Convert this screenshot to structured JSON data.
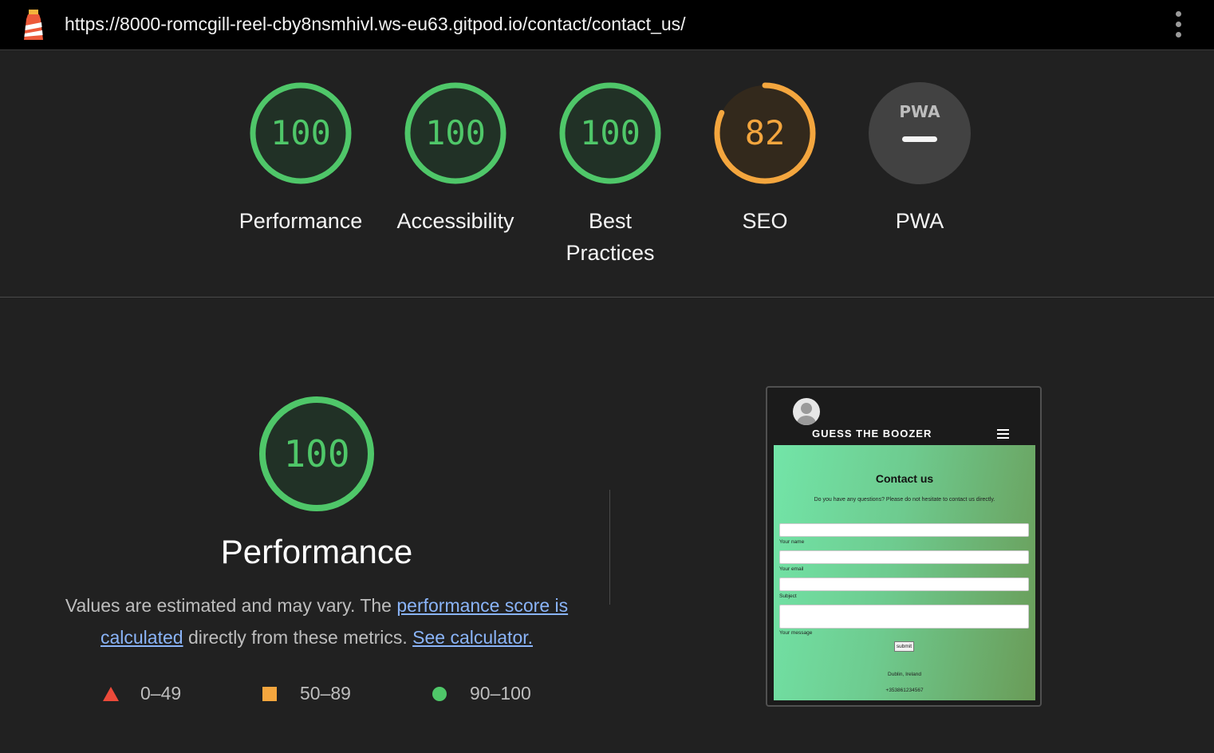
{
  "topbar": {
    "url": "https://8000-romcgill-reel-cby8nsmhivl.ws-eu63.gitpod.io/contact/contact_us/"
  },
  "colors": {
    "pass": "#4fc769",
    "average": "#f4a63e",
    "fail": "#ec4a3a",
    "link": "#8ab4f8"
  },
  "gauges": [
    {
      "label": "Performance",
      "score": "100",
      "value": 100,
      "status": "pass"
    },
    {
      "label": "Accessibility",
      "score": "100",
      "value": 100,
      "status": "pass"
    },
    {
      "label": "Best Practices",
      "score": "100",
      "value": 100,
      "status": "pass"
    },
    {
      "label": "SEO",
      "score": "82",
      "value": 82,
      "status": "average"
    },
    {
      "label": "PWA",
      "badge": "PWA",
      "status": "not-applicable"
    }
  ],
  "performance": {
    "score": "100",
    "title": "Performance",
    "desc_before": "Values are estimated and may vary. The ",
    "link_score": "performance score is calculated",
    "desc_middle": " directly from these metrics. ",
    "link_calc": "See calculator.",
    "legend": [
      {
        "range": "0–49",
        "shape": "triangle-icon"
      },
      {
        "range": "50–89",
        "shape": "square-icon"
      },
      {
        "range": "90–100",
        "shape": "circle-icon"
      }
    ]
  },
  "screenshot": {
    "brand": "GUESS THE BOOZER",
    "title": "Contact us",
    "subtitle": "Do you have any questions? Please do not hesitate to contact us directly.",
    "fields": [
      "Your name",
      "Your email",
      "Subject",
      "Your message"
    ],
    "submit": "submit",
    "location": "Dublin, Ireland",
    "phone": "+353861234567"
  }
}
